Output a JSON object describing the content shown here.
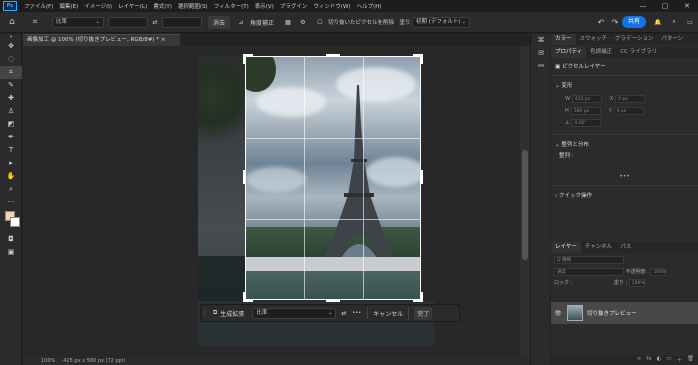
{
  "menu": {
    "logo": "Ps",
    "items": [
      "ファイル(F)",
      "編集(E)",
      "イメージ(I)",
      "レイヤー(L)",
      "書式(Y)",
      "選択範囲(S)",
      "フィルター(T)",
      "表示(V)",
      "プラグイン",
      "ウィンドウ(W)",
      "ヘルプ(H)"
    ],
    "window_controls": [
      "—",
      "▢",
      "✕"
    ]
  },
  "options": {
    "ratio": "比率",
    "clear": "消去",
    "straighten": "角度補正",
    "delete_cropped": "切り抜いたピクセルを削除",
    "fill_label": "塗り",
    "fill_value": "初期 (デフォルト)",
    "share": "共有"
  },
  "document": {
    "tab": "画像加工 @ 100% (切り抜きプレビュー, RGB/8#) *",
    "close": "×"
  },
  "context_bar": {
    "generative_fill": "生成拡張",
    "ratio": "比率",
    "more": "•••",
    "cancel": "キャンセル",
    "done": "完了"
  },
  "status": {
    "zoom": "100%",
    "size": "425 px x 580 px (72 ppi)"
  },
  "panels": {
    "top_tabs": [
      "カラー",
      "スウォッチ",
      "グラデーション",
      "パターン"
    ],
    "prop_tabs": [
      "プロパティ",
      "色調補正",
      "CC ライブラリ"
    ],
    "pixel_layer": "ピクセルレイヤー",
    "transform": "変形",
    "w_label": "W",
    "w_value": "425 px",
    "x_label": "X",
    "x_value": "0 px",
    "h_label": "H",
    "h_value": "580 px",
    "y_label": "Y",
    "y_value": "0 px",
    "angle": "0.00°",
    "align": "整列と分布",
    "align_label": "整列 :",
    "quick": "クイック操作",
    "more": "•••",
    "layer_tabs": [
      "レイヤー",
      "チャンネル",
      "パス"
    ],
    "kind": "Q 種類",
    "blend": "通常",
    "opacity_label": "不透明度 :",
    "opacity": "100%",
    "lock_label": "ロック :",
    "fill_label": "塗り :",
    "fill": "100%",
    "layer_name": "切り抜きプレビュー"
  }
}
